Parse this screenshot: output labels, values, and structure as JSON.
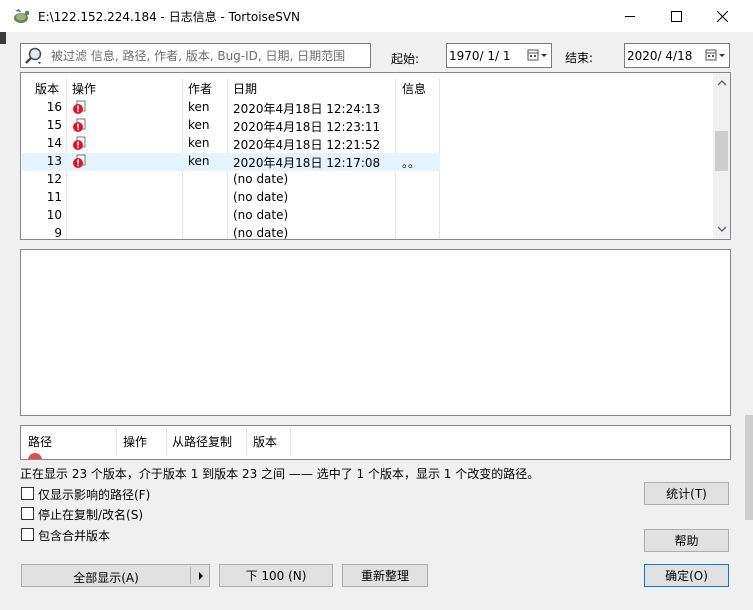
{
  "window": {
    "title": "E:\\122.152.224.184 - 日志信息 - TortoiseSVN"
  },
  "filter": {
    "placeholder": "被过滤 信息, 路径, 作者, 版本, Bug-ID, 日期, 日期范围",
    "start_label": "起始:",
    "start_date": "1970/  1/  1",
    "end_label": "结束:",
    "end_date": "2020/  4/18"
  },
  "revisions": {
    "columns": [
      "版本",
      "操作",
      "作者",
      "日期",
      "信息"
    ],
    "rows": [
      {
        "rev": "16",
        "author": "ken",
        "date": "2020年4月18日 12:24:13",
        "msg": "",
        "has_icon": true
      },
      {
        "rev": "15",
        "author": "ken",
        "date": "2020年4月18日 12:23:11",
        "msg": "",
        "has_icon": true
      },
      {
        "rev": "14",
        "author": "ken",
        "date": "2020年4月18日 12:21:52",
        "msg": "",
        "has_icon": true
      },
      {
        "rev": "13",
        "author": "ken",
        "date": "2020年4月18日 12:17:08",
        "msg": "。。",
        "has_icon": true,
        "selected": true
      },
      {
        "rev": "12",
        "author": "",
        "date": "(no date)",
        "msg": ""
      },
      {
        "rev": "11",
        "author": "",
        "date": "(no date)",
        "msg": ""
      },
      {
        "rev": "10",
        "author": "",
        "date": "(no date)",
        "msg": ""
      },
      {
        "rev": "9",
        "author": "",
        "date": "(no date)",
        "msg": ""
      }
    ]
  },
  "paths": {
    "columns": [
      "路径",
      "操作",
      "从路径复制",
      "版本"
    ]
  },
  "status_text": "正在显示 23 个版本，介于版本 1 到版本 23 之间 —— 选中了 1 个版本，显示 1 个改变的路径。",
  "options": {
    "affected_paths": "仅显示影响的路径(F)",
    "stop_on_copy": "停止在复制/改名(S)",
    "include_merged": "包含合并版本"
  },
  "buttons": {
    "show_all": "全部显示(A)",
    "next_100": "下 100 (N)",
    "refresh": "重新整理",
    "statistics": "统计(T)",
    "help": "帮助",
    "ok": "确定(O)"
  },
  "colors": {
    "selection": "#e5f3ff",
    "error_red": "#e81123",
    "default_button_border": "#0078d7"
  },
  "icons": {
    "title": "tortoisesvn-icon",
    "search": "magnifier-icon",
    "calendar": "calendar-dropdown-icon",
    "action": "modified-file-icon"
  }
}
